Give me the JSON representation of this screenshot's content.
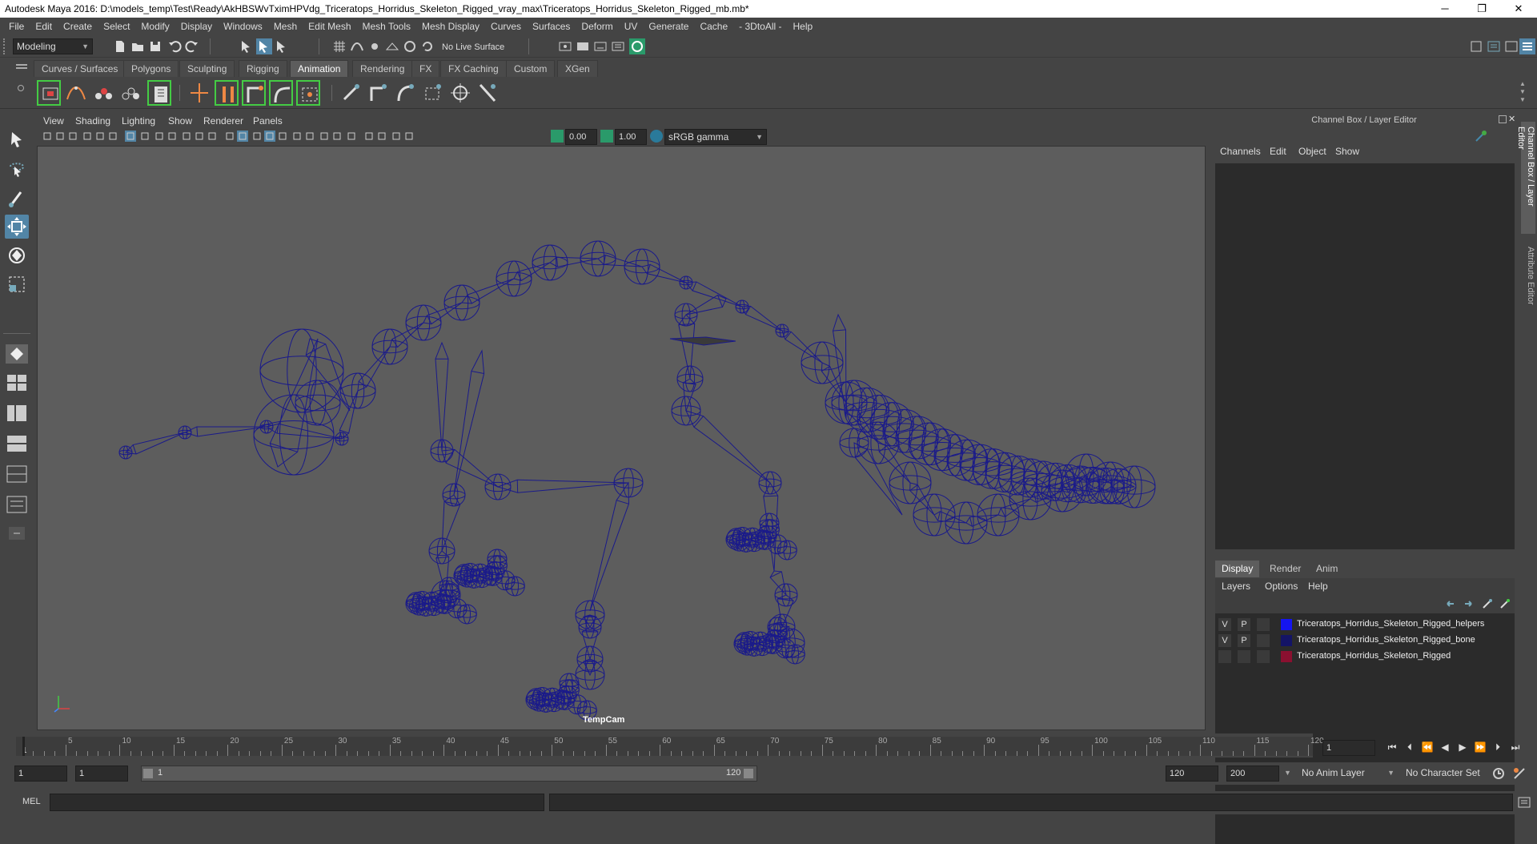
{
  "window": {
    "title": "Autodesk Maya 2016: D:\\models_temp\\Test\\Ready\\AkHBSWvTximHPVdg_Triceratops_Horridus_Skeleton_Rigged_vray_max\\Triceratops_Horridus_Skeleton_Rigged_mb.mb*",
    "minimize": "─",
    "restore": "❐",
    "close": "✕"
  },
  "menubar": [
    "File",
    "Edit",
    "Create",
    "Select",
    "Modify",
    "Display",
    "Windows",
    "Mesh",
    "Edit Mesh",
    "Mesh Tools",
    "Mesh Display",
    "Curves",
    "Surfaces",
    "Deform",
    "UV",
    "Generate",
    "Cache",
    "- 3DtoAll -",
    "Help"
  ],
  "statusline": {
    "mode": "Modeling",
    "live_surface": "No Live Surface"
  },
  "shelf_tabs": [
    {
      "label": "Curves / Surfaces",
      "active": false
    },
    {
      "label": "Polygons",
      "active": false
    },
    {
      "label": "Sculpting",
      "active": false
    },
    {
      "label": "Rigging",
      "active": false
    },
    {
      "label": "Animation",
      "active": true
    },
    {
      "label": "Rendering",
      "active": false
    },
    {
      "label": "FX",
      "active": false
    },
    {
      "label": "FX Caching",
      "active": false
    },
    {
      "label": "Custom",
      "active": false
    },
    {
      "label": "XGen",
      "active": false
    }
  ],
  "viewport": {
    "menu": [
      "View",
      "Shading",
      "Lighting",
      "Show",
      "Renderer",
      "Panels"
    ],
    "exposure": "0.00",
    "gamma": "1.00",
    "color_space": "sRGB gamma",
    "camera": "TempCam",
    "wire_color": "#1a1a8a",
    "bg_color": "#5d5d5d"
  },
  "channel_box": {
    "title": "Channel Box / Layer Editor",
    "menu": [
      "Channels",
      "Edit",
      "Object",
      "Show"
    ]
  },
  "layer_editor": {
    "tabs": [
      {
        "label": "Display",
        "active": true
      },
      {
        "label": "Render",
        "active": false
      },
      {
        "label": "Anim",
        "active": false
      }
    ],
    "menu": [
      "Layers",
      "Options",
      "Help"
    ],
    "layers": [
      {
        "v": "V",
        "p": "P",
        "color": "#1515f0",
        "name": "Triceratops_Horridus_Skeleton_Rigged_helpers"
      },
      {
        "v": "V",
        "p": "P",
        "color": "#141466",
        "name": "Triceratops_Horridus_Skeleton_Rigged_bone"
      },
      {
        "v": "",
        "p": "",
        "color": "#8a1030",
        "name": "Triceratops_Horridus_Skeleton_Rigged"
      }
    ]
  },
  "side_tabs": [
    "Channel Box / Layer Editor",
    "Attribute Editor"
  ],
  "timeline": {
    "ticks": [
      "5",
      "10",
      "15",
      "20",
      "25",
      "30",
      "35",
      "40",
      "45",
      "50",
      "55",
      "60",
      "65",
      "70",
      "75",
      "80",
      "85",
      "90",
      "95",
      "100",
      "105",
      "110",
      "115",
      "120"
    ],
    "first_label": "1",
    "current_frame": "1"
  },
  "range": {
    "start": "1",
    "playback_start": "1",
    "slider_start": "1",
    "slider_end": "120",
    "playback_end": "120",
    "end": "200",
    "anim_layer": "No Anim Layer",
    "character_set": "No Character Set"
  },
  "command_line": {
    "label": "MEL"
  }
}
